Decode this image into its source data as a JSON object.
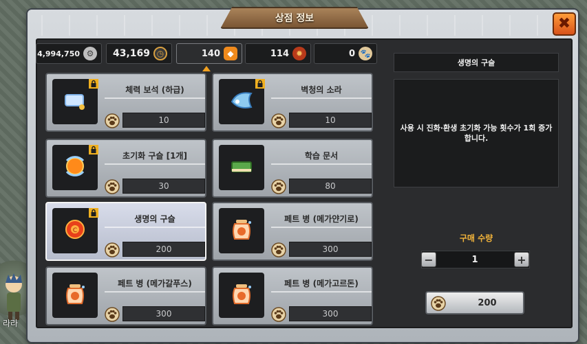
{
  "window": {
    "title": "상점 정보",
    "close_icon": "close-icon"
  },
  "currencies": [
    {
      "id": "coin",
      "value": "4,994,750",
      "icon": "coin-icon",
      "color": "#c8c8c8"
    },
    {
      "id": "stopwatch",
      "value": "43,169",
      "icon": "stopwatch-icon",
      "color": "#d8a040"
    },
    {
      "id": "gem",
      "value": "140",
      "icon": "orange-gem-icon",
      "color": "#f08a1c",
      "active": true
    },
    {
      "id": "medal",
      "value": "114",
      "icon": "medal-icon",
      "color": "#b83a1a"
    },
    {
      "id": "paw",
      "value": "0",
      "icon": "paw-token-icon",
      "color": "#e0c89a"
    }
  ],
  "items": [
    {
      "name": "체력 보석 (하급)",
      "price": "10",
      "icon": "scroll-icon",
      "locked": true
    },
    {
      "name": "벽청의 소라",
      "price": "10",
      "icon": "conch-shell-icon",
      "locked": true
    },
    {
      "name": "초기화 구슬 [1개]",
      "price": "30",
      "icon": "reset-orb-icon",
      "locked": true
    },
    {
      "name": "학습 문서",
      "price": "80",
      "icon": "book-icon",
      "locked": false
    },
    {
      "name": "생명의 구슬",
      "price": "200",
      "icon": "life-orb-icon",
      "locked": true,
      "selected": true
    },
    {
      "name": "페트 병 (메가얀기로)",
      "price": "300",
      "icon": "pet-jar-icon",
      "locked": false
    },
    {
      "name": "페트 병 (메가갈푸스)",
      "price": "300",
      "icon": "pet-jar-icon",
      "locked": false
    },
    {
      "name": "페트 병 (메가고르돈)",
      "price": "300",
      "icon": "pet-jar-icon",
      "locked": false
    }
  ],
  "detail": {
    "title": "생명의 구슬",
    "description": "사용 시 진화·환생 초기화 가능 횟수가 1회 증가합니다."
  },
  "purchase": {
    "quantity_label": "구매 수량",
    "quantity": "1",
    "minus": "−",
    "plus": "+",
    "price": "200"
  },
  "character": {
    "name": "라라"
  }
}
